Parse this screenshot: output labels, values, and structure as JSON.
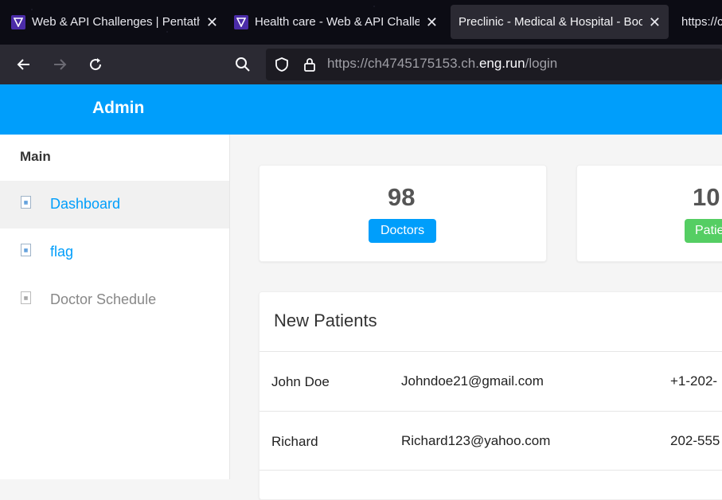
{
  "browser": {
    "tabs": [
      {
        "title": "Web & API Challenges | Pentath",
        "active": false
      },
      {
        "title": "Health care - Web & API Challe",
        "active": false
      },
      {
        "title": "Preclinic - Medical & Hospital - Boo",
        "active": true
      },
      {
        "title": "https://c",
        "active": false
      }
    ],
    "url_prefix": "https://ch4745175153.ch.",
    "url_host": "eng.run",
    "url_path": "/login"
  },
  "header": {
    "brand": "Admin",
    "color": "#009efb"
  },
  "sidebar": {
    "menu_title": "Main",
    "items": [
      {
        "label": "Dashboard",
        "active": true
      },
      {
        "label": "flag",
        "active": false
      },
      {
        "label": "Doctor Schedule",
        "active": false
      }
    ]
  },
  "stats": [
    {
      "value": "98",
      "label": "Doctors",
      "color": "#009efb"
    },
    {
      "value": "10",
      "label": "Patie",
      "color": "#55ce63"
    }
  ],
  "new_patients": {
    "title": "New Patients",
    "rows": [
      {
        "name": "John Doe",
        "email": "Johndoe21@gmail.com",
        "phone": "+1-202-"
      },
      {
        "name": "Richard",
        "email": "Richard123@yahoo.com",
        "phone": "202-555"
      }
    ]
  }
}
